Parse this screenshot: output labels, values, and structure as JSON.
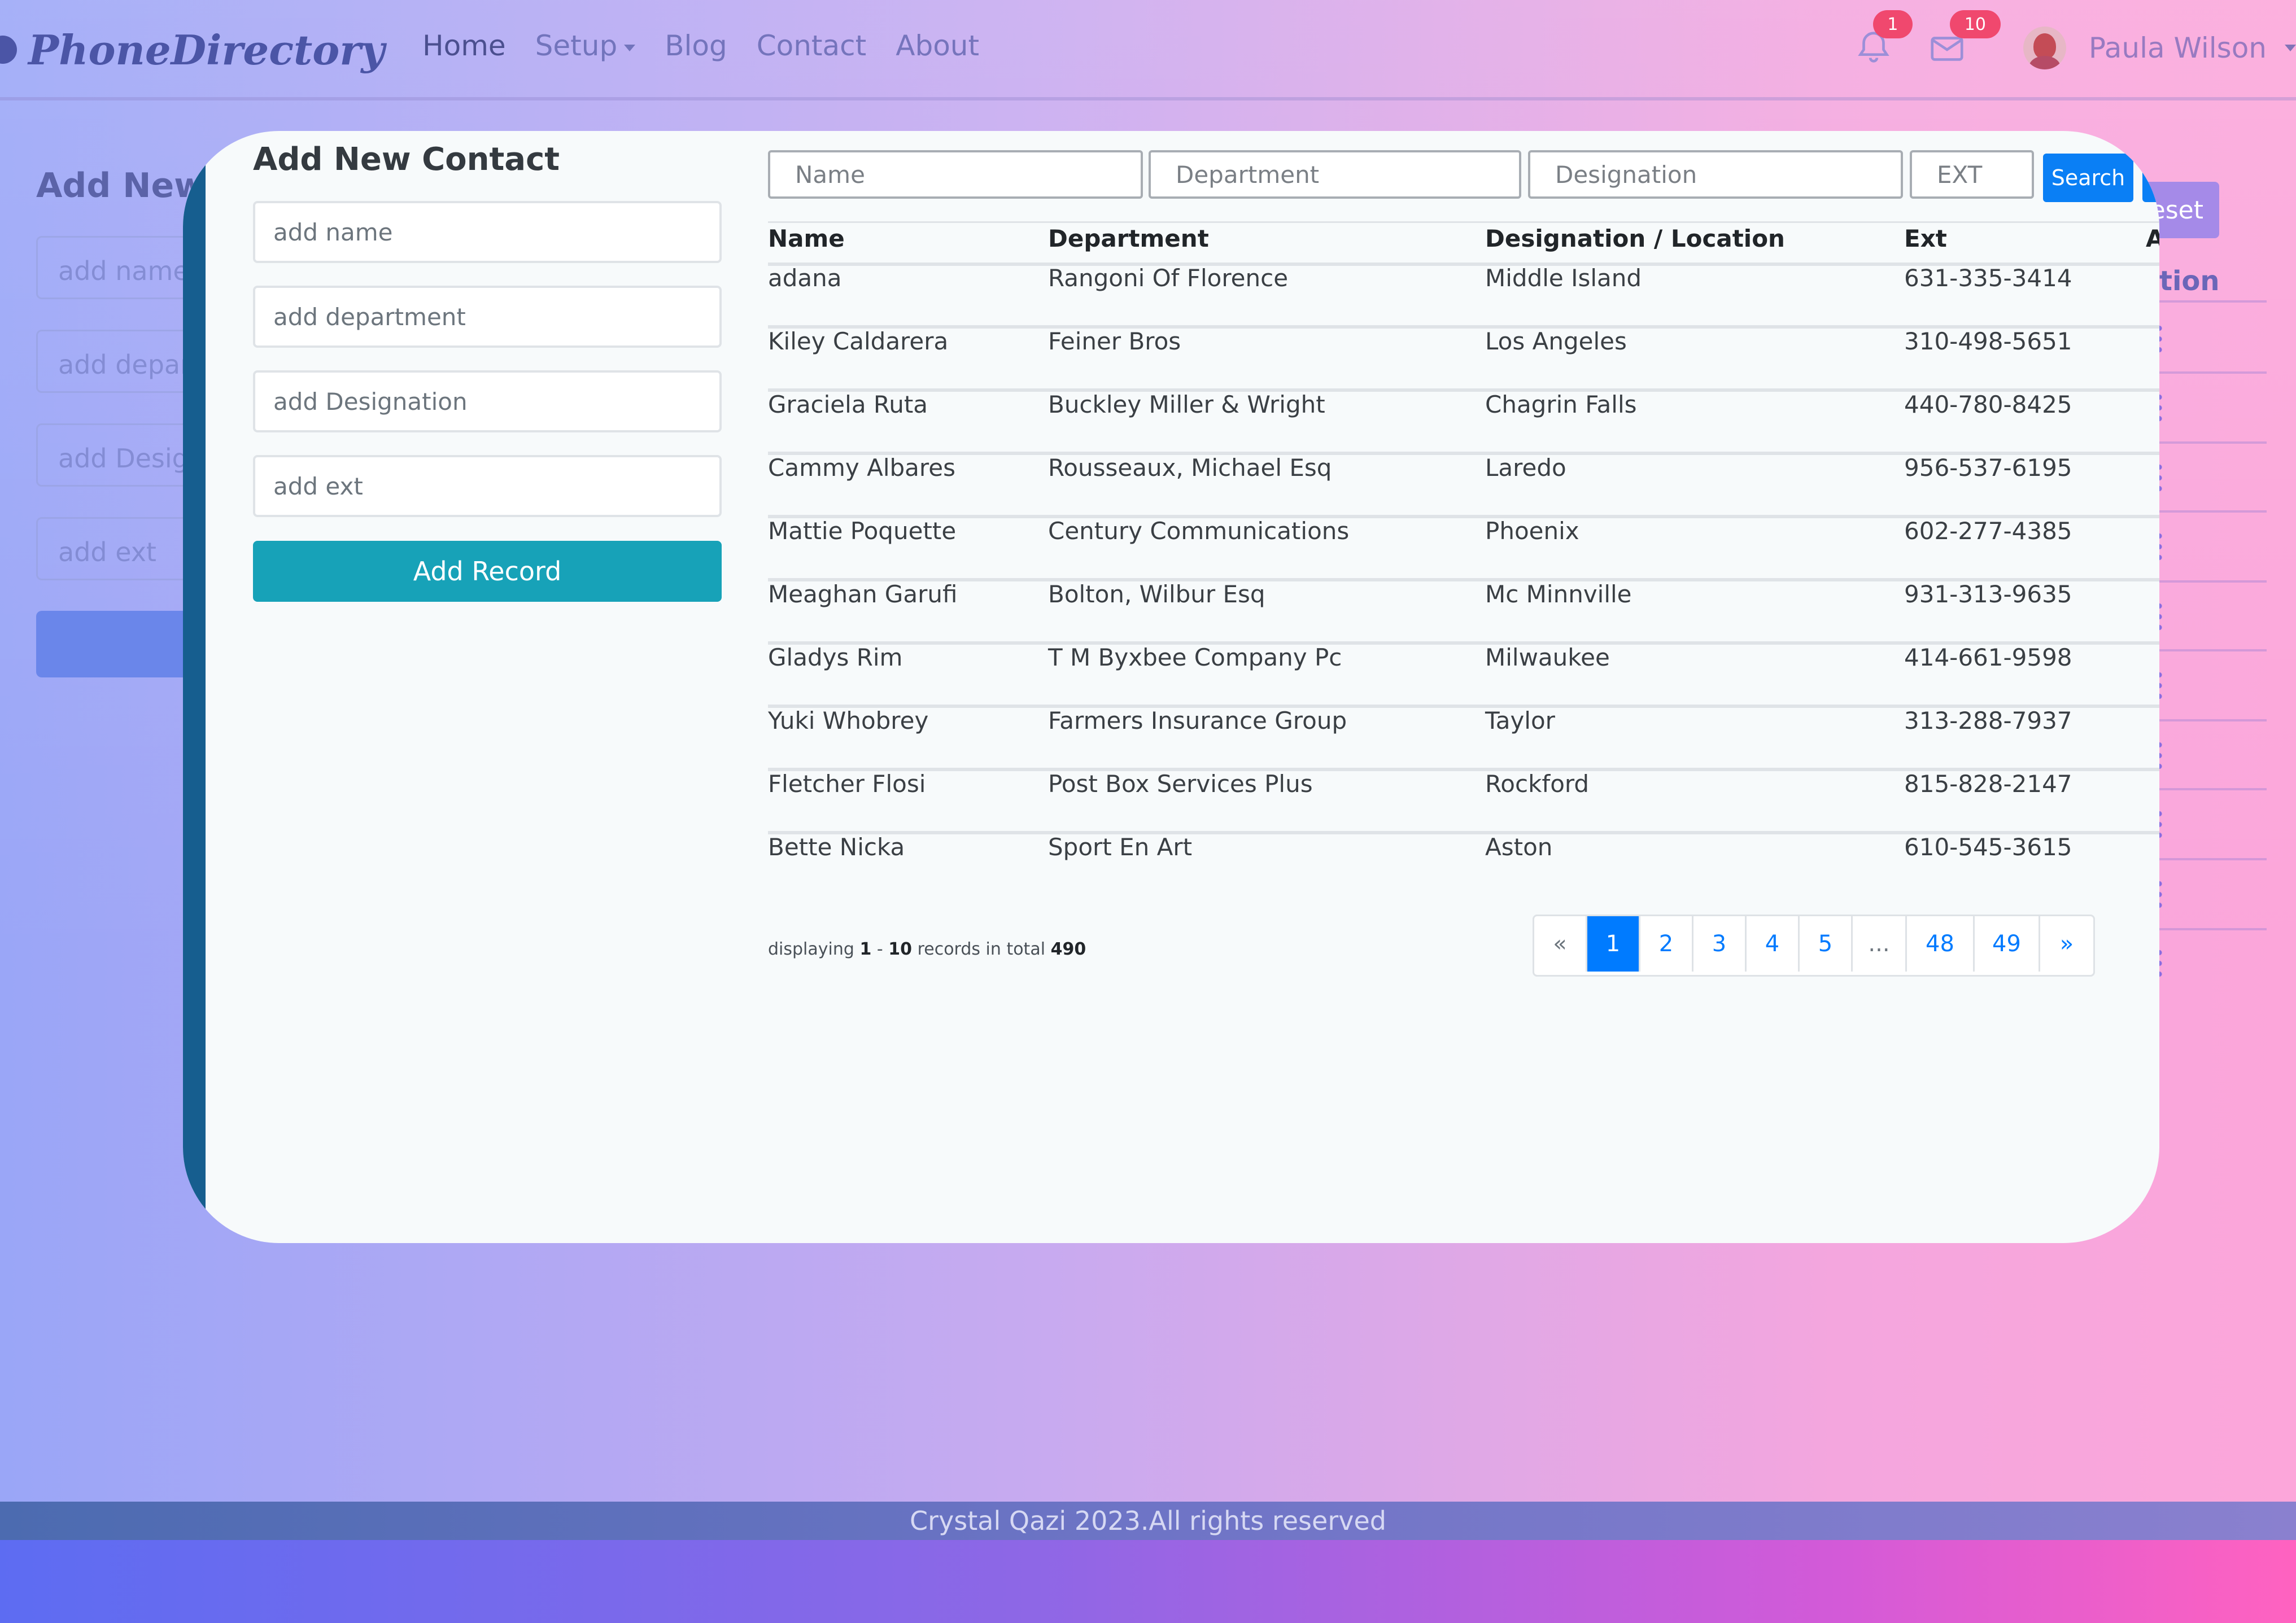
{
  "navbar": {
    "brand": "PhoneDirectory",
    "links": [
      {
        "label": "Home",
        "active": true
      },
      {
        "label": "Setup",
        "dropdown": true
      },
      {
        "label": "Blog"
      },
      {
        "label": "Contact"
      },
      {
        "label": "About"
      }
    ],
    "notifications_count": "1",
    "messages_count": "10",
    "user_name": "Paula Wilson",
    "icons": [
      "bell-icon",
      "envelope-icon",
      "avatar"
    ]
  },
  "background_page": {
    "title": "Add New",
    "fields": [
      "add name",
      "add depar",
      "add Desig",
      "add ext"
    ],
    "reset_label": "eset",
    "action_header": "tion"
  },
  "form": {
    "title": "Add New Contact",
    "name_placeholder": "add name",
    "department_placeholder": "add department",
    "designation_placeholder": "add Designation",
    "ext_placeholder": "add ext",
    "submit_label": "Add Record"
  },
  "search": {
    "name_placeholder": "Name",
    "department_placeholder": "Department",
    "designation_placeholder": "Designation",
    "ext_placeholder": "EXT",
    "search_label": "Search"
  },
  "table": {
    "headers": [
      "Name",
      "Department",
      "Designation / Location",
      "Ext",
      "A"
    ],
    "rows": [
      {
        "name": "adana",
        "department": "Rangoni Of Florence",
        "designation": "Middle Island",
        "ext": "631-335-3414"
      },
      {
        "name": "Kiley Caldarera",
        "department": "Feiner Bros",
        "designation": "Los Angeles",
        "ext": "310-498-5651"
      },
      {
        "name": "Graciela Ruta",
        "department": "Buckley Miller & Wright",
        "designation": "Chagrin Falls",
        "ext": "440-780-8425"
      },
      {
        "name": "Cammy Albares",
        "department": "Rousseaux, Michael Esq",
        "designation": "Laredo",
        "ext": "956-537-6195"
      },
      {
        "name": "Mattie Poquette",
        "department": "Century Communications",
        "designation": "Phoenix",
        "ext": "602-277-4385"
      },
      {
        "name": "Meaghan Garufi",
        "department": "Bolton, Wilbur Esq",
        "designation": "Mc Minnville",
        "ext": "931-313-9635"
      },
      {
        "name": "Gladys Rim",
        "department": "T M Byxbee Company Pc",
        "designation": "Milwaukee",
        "ext": "414-661-9598"
      },
      {
        "name": "Yuki Whobrey",
        "department": "Farmers Insurance Group",
        "designation": "Taylor",
        "ext": "313-288-7937"
      },
      {
        "name": "Fletcher Flosi",
        "department": "Post Box Services Plus",
        "designation": "Rockford",
        "ext": "815-828-2147"
      },
      {
        "name": "Bette Nicka",
        "department": "Sport En Art",
        "designation": "Aston",
        "ext": "610-545-3615"
      }
    ]
  },
  "summary": {
    "prefix": "displaying",
    "from": "1",
    "sep": "-",
    "to": "10",
    "middle": "records in total",
    "total": "490"
  },
  "pagination": {
    "items": [
      {
        "label": "«",
        "type": "prev"
      },
      {
        "label": "1",
        "active": true
      },
      {
        "label": "2"
      },
      {
        "label": "3"
      },
      {
        "label": "4"
      },
      {
        "label": "5"
      },
      {
        "label": "...",
        "type": "ellipsis"
      },
      {
        "label": "48"
      },
      {
        "label": "49"
      },
      {
        "label": "»",
        "type": "next"
      }
    ]
  },
  "footer": {
    "text": "Crystal Qazi 2023.All rights reserved"
  },
  "colors": {
    "primary": "#007bff",
    "teal": "#17a2b8",
    "badge": "#f0486e",
    "modal_stripe": "#165e8f"
  }
}
